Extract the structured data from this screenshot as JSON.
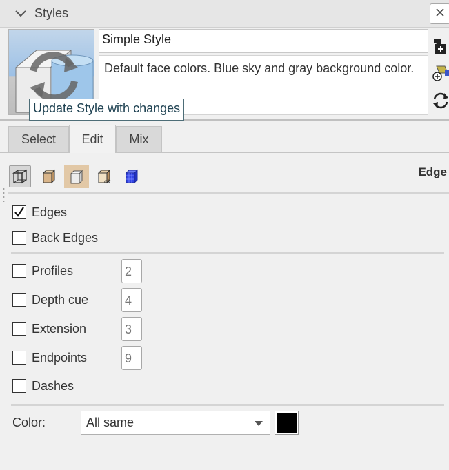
{
  "header": {
    "title": "Styles"
  },
  "style": {
    "name": "Simple Style",
    "description": "Default face colors. Blue sky and gray background color."
  },
  "tooltip": {
    "text": "Update Style with changes"
  },
  "tabs": [
    {
      "label": "Select"
    },
    {
      "label": "Edit",
      "active": true
    },
    {
      "label": "Mix"
    }
  ],
  "edit_panel": {
    "section_label": "Edge",
    "category_icons": [
      "edge-settings-icon",
      "face-settings-icon",
      "background-settings-icon",
      "watermark-settings-icon",
      "modeling-settings-icon"
    ],
    "options": {
      "edges": {
        "label": "Edges",
        "checked": true
      },
      "back_edges": {
        "label": "Back Edges",
        "checked": false
      },
      "profiles": {
        "label": "Profiles",
        "checked": false,
        "value": "2"
      },
      "depth_cue": {
        "label": "Depth cue",
        "checked": false,
        "value": "4"
      },
      "extension": {
        "label": "Extension",
        "checked": false,
        "value": "3"
      },
      "endpoints": {
        "label": "Endpoints",
        "checked": false,
        "value": "9"
      },
      "dashes": {
        "label": "Dashes",
        "checked": false
      }
    },
    "color": {
      "label": "Color:",
      "selected": "All same",
      "swatch": "#000000"
    }
  },
  "colors": {
    "tooltip_border": "#4d6d77",
    "tab_active": "#f2f2f2",
    "tab_inactive": "#d9d9d9"
  }
}
